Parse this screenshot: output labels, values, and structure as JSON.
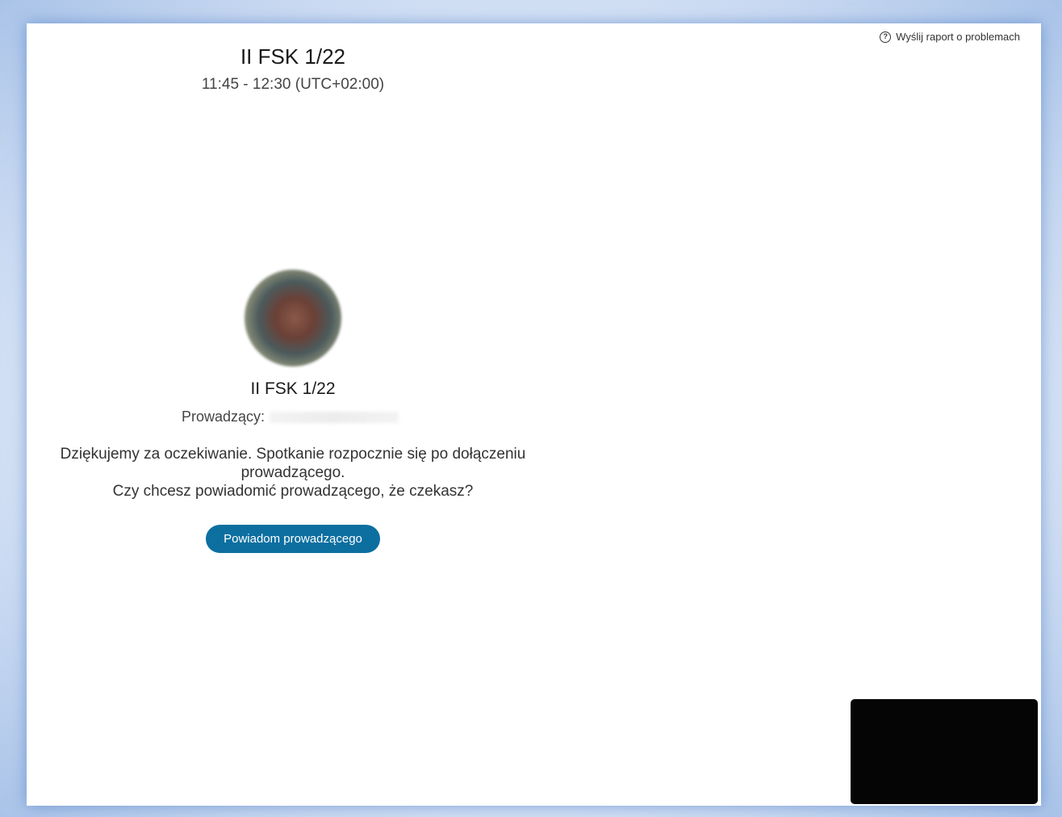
{
  "report": {
    "label": "Wyślij raport o problemach",
    "icon": "help-circle-icon"
  },
  "header": {
    "title": "II FSK 1/22",
    "time": "11:45 - 12:30 (UTC+02:00)"
  },
  "meeting": {
    "name": "II FSK 1/22",
    "host_label": "Prowadzący:",
    "message_line1": "Dziękujemy za oczekiwanie. Spotkanie rozpocznie się po dołączeniu prowadzącego.",
    "message_line2": "Czy chcesz powiadomić prowadzącego, że czekasz?",
    "notify_button": "Powiadom prowadzącego"
  },
  "colors": {
    "accent": "#0c6fa0",
    "self_video_bg": "#050505"
  }
}
